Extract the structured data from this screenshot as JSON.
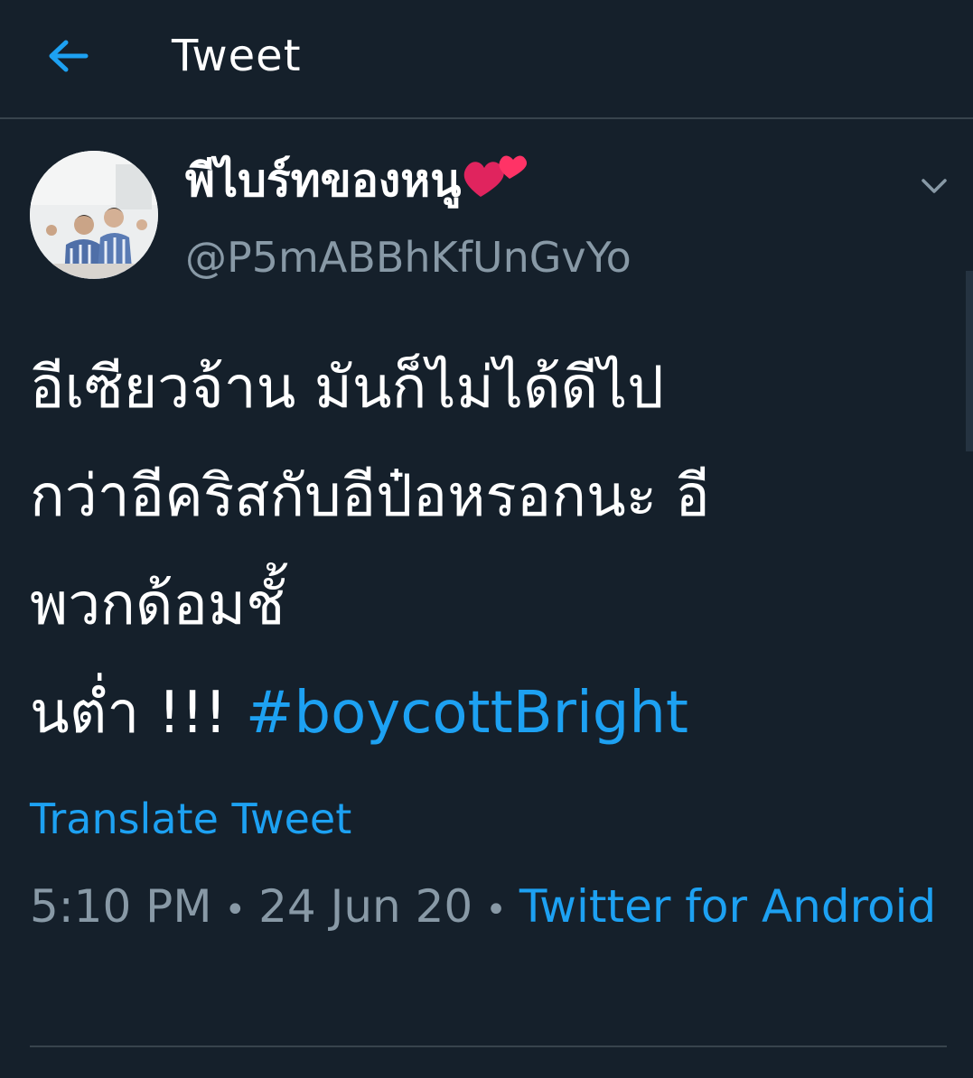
{
  "header": {
    "title": "Tweet",
    "back_icon": "arrow-left-icon",
    "accent": "#1da1f2"
  },
  "tweet": {
    "display_name": "พีไบร์ทของหนู",
    "display_name_emoji": "two-hearts-icon",
    "handle": "@P5mABBhKfUnGvYo",
    "body_lines": [
      "อีเซียวจ้าน มันก็ไม่ได้ดีไป",
      "กว่าอีคริสกับอีป๋อหรอกนะ อี",
      "พวกด้อมชั้"
    ],
    "body_last_text": "นต่ำ !!! ",
    "hashtag": "#boycottBright",
    "translate_label": "Translate Tweet",
    "time": "5:10 PM",
    "date": "24 Jun 20",
    "separator": "•",
    "source": "Twitter for Android"
  },
  "colors": {
    "background": "#15202b",
    "text": "#ffffff",
    "muted": "#8899a6",
    "link": "#1da1f2",
    "divider": "#38444d"
  }
}
